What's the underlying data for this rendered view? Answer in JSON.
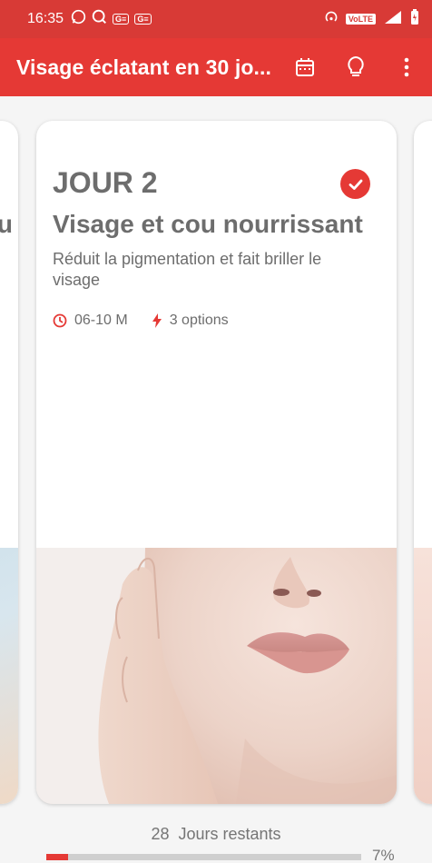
{
  "status_bar": {
    "time": "16:35",
    "volte": "VoLTE",
    "net": "4G+"
  },
  "app_bar": {
    "title": "Visage éclatant en 30 jo...",
    "actions": [
      "calendar-icon",
      "lightbulb-icon",
      "more-vert-icon"
    ]
  },
  "cards": {
    "prev": {
      "partial_title": "u"
    },
    "main": {
      "day": "JOUR 2",
      "completed": true,
      "title": "Visage et cou nourrissant",
      "description": "Réduit la pigmentation et fait briller le visage",
      "time": "06-10 M",
      "options": "3 options"
    }
  },
  "footer": {
    "days_left_number": "28",
    "days_left_label": "Jours restants",
    "progress_text": "7%",
    "progress_fraction": 0.07
  },
  "colors": {
    "accent": "#e53935",
    "status_bar": "#d83a36",
    "text_gray": "#6d6d6d"
  }
}
